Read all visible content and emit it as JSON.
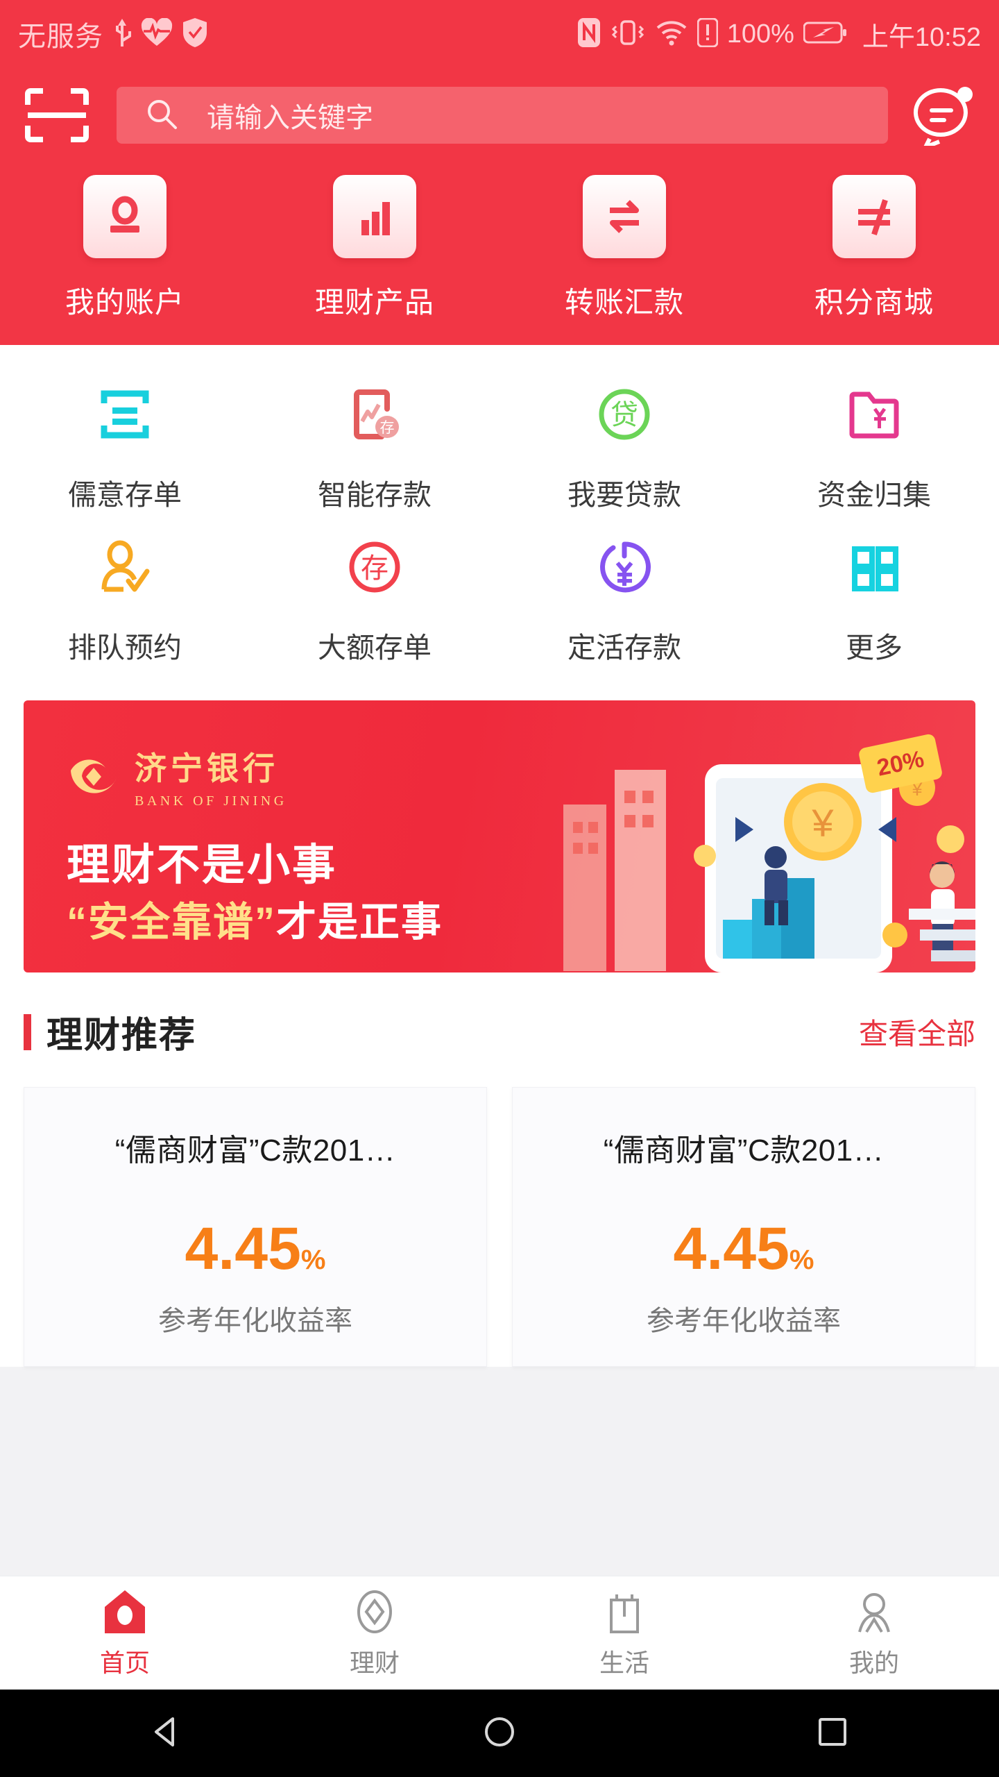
{
  "statusbar": {
    "carrier": "无服务",
    "battery_text": "100%",
    "time": "上午10:52",
    "icons": [
      "usb-icon",
      "heartbeat-icon",
      "shield-check-icon",
      "nfc-icon",
      "vibrate-icon",
      "wifi-icon",
      "alert-icon",
      "battery-icon"
    ]
  },
  "header": {
    "scan_icon": "scan-icon",
    "search": {
      "placeholder": "请输入关键字",
      "icon": "search-icon"
    },
    "message_icon": "message-icon",
    "quick_actions": [
      {
        "label": "我的账户",
        "icon": "account-icon"
      },
      {
        "label": "理财产品",
        "icon": "bar-chart-icon"
      },
      {
        "label": "转账汇款",
        "icon": "transfer-icon"
      },
      {
        "label": "积分商城",
        "icon": "points-mall-icon"
      }
    ]
  },
  "services": {
    "rows": [
      [
        {
          "label": "儒意存单",
          "icon": "certificate-icon",
          "color": "#18cfdd"
        },
        {
          "label": "智能存款",
          "icon": "smart-deposit-icon",
          "color": "#e25c5c"
        },
        {
          "label": "我要贷款",
          "icon": "loan-icon",
          "color": "#6bd457"
        },
        {
          "label": "资金归集",
          "icon": "fund-collect-icon",
          "color": "#e4388e"
        }
      ],
      [
        {
          "label": "排队预约",
          "icon": "queue-booking-icon",
          "color": "#f7a922"
        },
        {
          "label": "大额存单",
          "icon": "large-deposit-icon",
          "color": "#f2414c"
        },
        {
          "label": "定活存款",
          "icon": "time-deposit-icon",
          "color": "#8653f0"
        },
        {
          "label": "更多",
          "icon": "more-grid-icon",
          "color": "#16d2e0"
        }
      ]
    ]
  },
  "banner": {
    "bank_name_cn": "济宁银行",
    "bank_name_en": "BANK OF JINING",
    "line1": "理财不是小事",
    "line2_quote": "“安全靠谱”",
    "line2_rest": "才是正事",
    "tag": "20%",
    "logo_icon": "jining-bank-logo-icon"
  },
  "section": {
    "title": "理财推荐",
    "more": "查看全部"
  },
  "products": [
    {
      "name": "“儒商财富”C款201…",
      "rate": "4.45",
      "percent": "%",
      "sub": "参考年化收益率"
    },
    {
      "name": "“儒商财富”C款201…",
      "rate": "4.45",
      "percent": "%",
      "sub": "参考年化收益率"
    }
  ],
  "tabbar": [
    {
      "label": "首页",
      "icon": "home-icon",
      "active": true
    },
    {
      "label": "理财",
      "icon": "finance-diamond-icon",
      "active": false
    },
    {
      "label": "生活",
      "icon": "life-bag-icon",
      "active": false
    },
    {
      "label": "我的",
      "icon": "person-icon",
      "active": false
    }
  ],
  "navbar": [
    {
      "icon": "back-triangle-icon"
    },
    {
      "icon": "home-circle-icon"
    },
    {
      "icon": "recents-square-icon"
    }
  ],
  "colors": {
    "brand_red": "#f23645",
    "accent_red": "#e8323f",
    "rate_orange": "#f77f17",
    "highlight_pink": "#fadfe3"
  }
}
